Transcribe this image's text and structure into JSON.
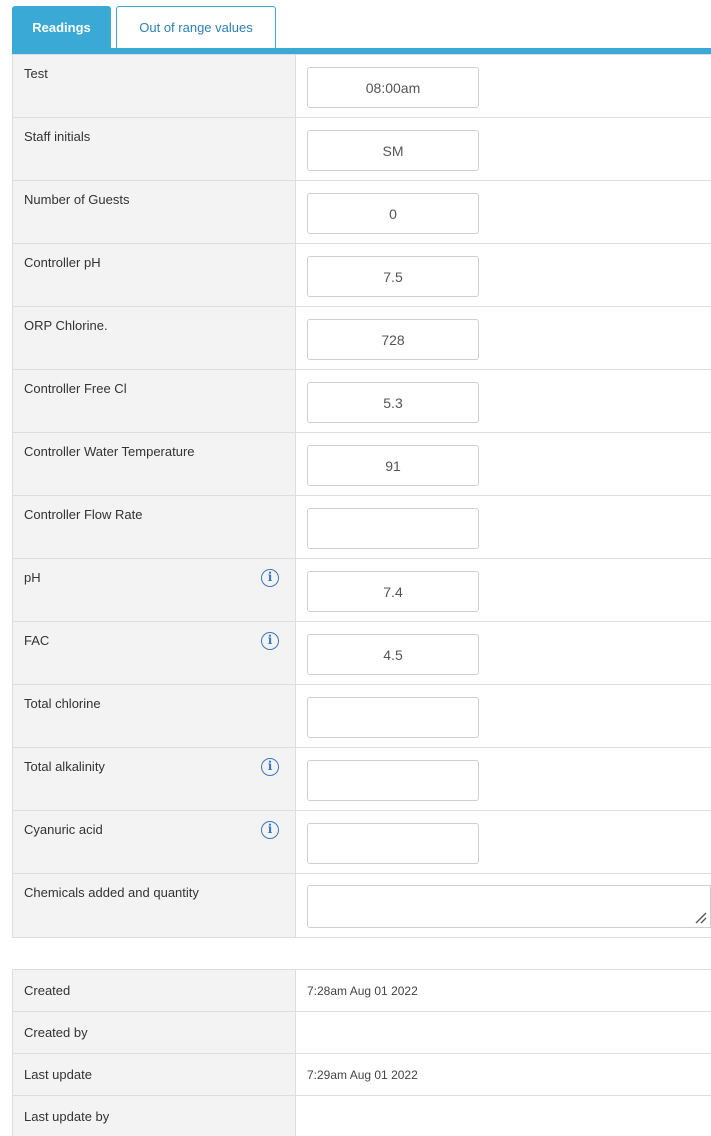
{
  "tabs": [
    {
      "label": "Readings",
      "active": true
    },
    {
      "label": "Out of range values",
      "active": false
    }
  ],
  "readings": [
    {
      "label": "Test",
      "value": "08:00am",
      "info": false
    },
    {
      "label": "Staff initials",
      "value": "SM",
      "info": false
    },
    {
      "label": "Number of Guests",
      "value": "0",
      "info": false
    },
    {
      "label": "Controller pH",
      "value": "7.5",
      "info": false
    },
    {
      "label": "ORP Chlorine.",
      "value": "728",
      "info": false
    },
    {
      "label": "Controller Free Cl",
      "value": "5.3",
      "info": false
    },
    {
      "label": "Controller Water Temperature",
      "value": "91",
      "info": false
    },
    {
      "label": "Controller Flow Rate",
      "value": "",
      "info": false
    },
    {
      "label": "pH",
      "value": "7.4",
      "info": true
    },
    {
      "label": "FAC",
      "value": "4.5",
      "info": true
    },
    {
      "label": "Total chlorine",
      "value": "",
      "info": false
    },
    {
      "label": "Total alkalinity",
      "value": "",
      "info": true
    },
    {
      "label": "Cyanuric acid",
      "value": "",
      "info": true
    }
  ],
  "chemicals": {
    "label": "Chemicals added and quantity",
    "value": ""
  },
  "info_icon_glyph": "i",
  "meta": {
    "created_label": "Created",
    "created_value": "7:28am Aug 01 2022",
    "created_by_label": "Created by",
    "created_by_value": "",
    "last_update_label": "Last update",
    "last_update_value": "7:29am Aug 01 2022",
    "last_update_by_label": "Last update by",
    "last_update_by_value": ""
  },
  "colors": {
    "accent": "#3aa9d6",
    "info_icon": "#3a78c2",
    "label_bg": "#f3f3f3"
  }
}
